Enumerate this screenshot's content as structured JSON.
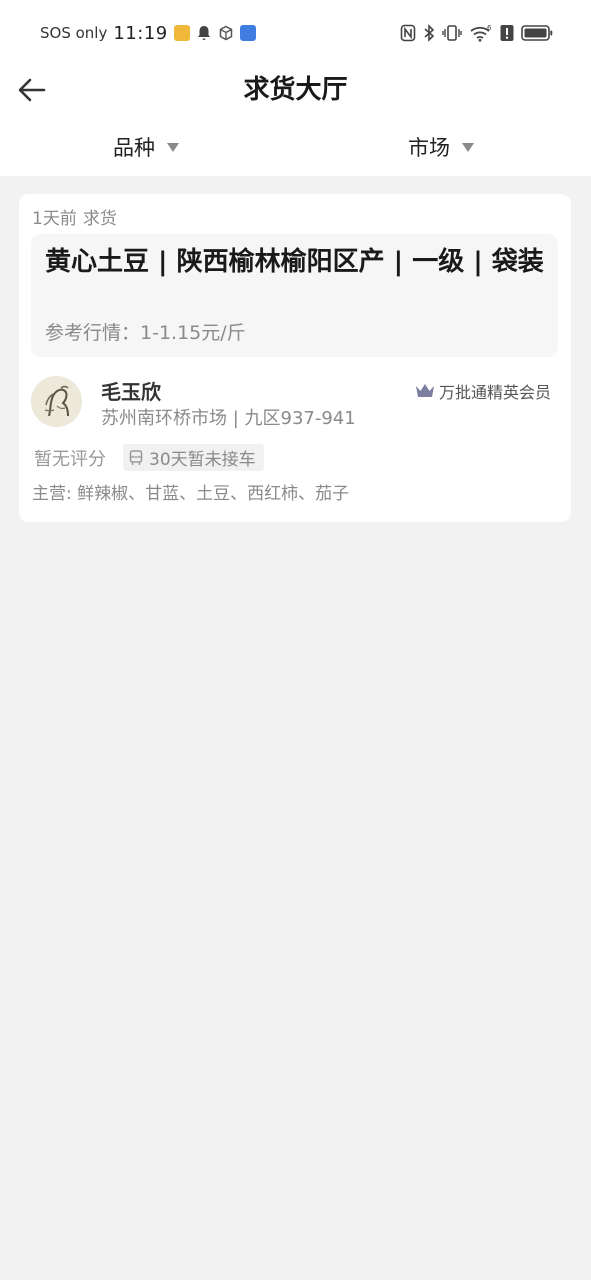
{
  "status_bar": {
    "sos": "SOS only",
    "time": "11:19",
    "icons": [
      "app-notification-icon",
      "bell-icon",
      "box-icon",
      "app-bird-icon",
      "nfc-icon",
      "bluetooth-icon",
      "vibrate-icon",
      "wifi-icon",
      "alert-icon",
      "battery-icon"
    ]
  },
  "header": {
    "title": "求货大厅",
    "filters": [
      {
        "label": "品种"
      },
      {
        "label": "市场"
      }
    ]
  },
  "listing": {
    "time_ago": "1天前",
    "type": "求货",
    "product_title": "黄心土豆 | 陕西榆林榆阳区产 | 一级 | 袋装",
    "price_ref": "参考行情：1-1.15元/斤",
    "seller": {
      "name": "毛玉欣",
      "market": "苏州南环桥市场 | 九区937-941",
      "badge": "万批通精英会员",
      "rating": "暂无评分",
      "pickup": "30天暂未接车",
      "main_items": "主营: 鲜辣椒、甘蓝、土豆、西红柿、茄子"
    }
  },
  "colors": {
    "background": "#f2f2f2",
    "card": "#ffffff",
    "crown": "#7b7e9e"
  }
}
